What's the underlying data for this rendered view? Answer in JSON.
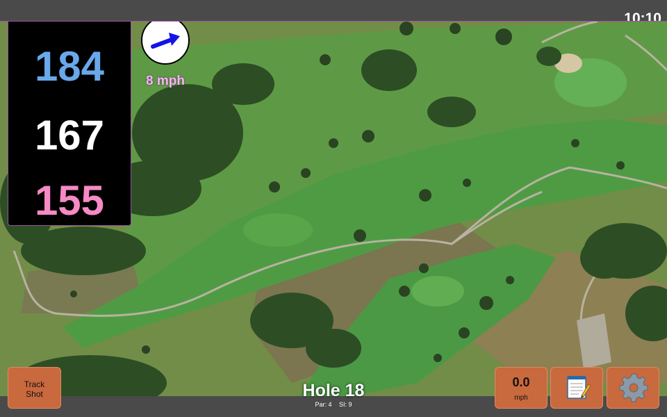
{
  "status": {
    "time": "10:10"
  },
  "distances": {
    "back": "184",
    "center": "167",
    "front": "155"
  },
  "wind": {
    "speed_label": "8 mph",
    "arrow_icon": "wind-arrow-icon"
  },
  "hole": {
    "title": "Hole 18",
    "par": "Par: 4",
    "stroke_index": "SI: 9"
  },
  "buttons": {
    "track_shot": "Track\nShot",
    "speed_value": "0.0",
    "speed_unit": "mph",
    "notes_icon": "notepad-icon",
    "settings_icon": "gear-icon"
  },
  "colors": {
    "back": "#69a8ea",
    "center": "#ffffff",
    "front": "#f58ac5",
    "button": "#c9693e",
    "accent": "#9b55a3"
  }
}
